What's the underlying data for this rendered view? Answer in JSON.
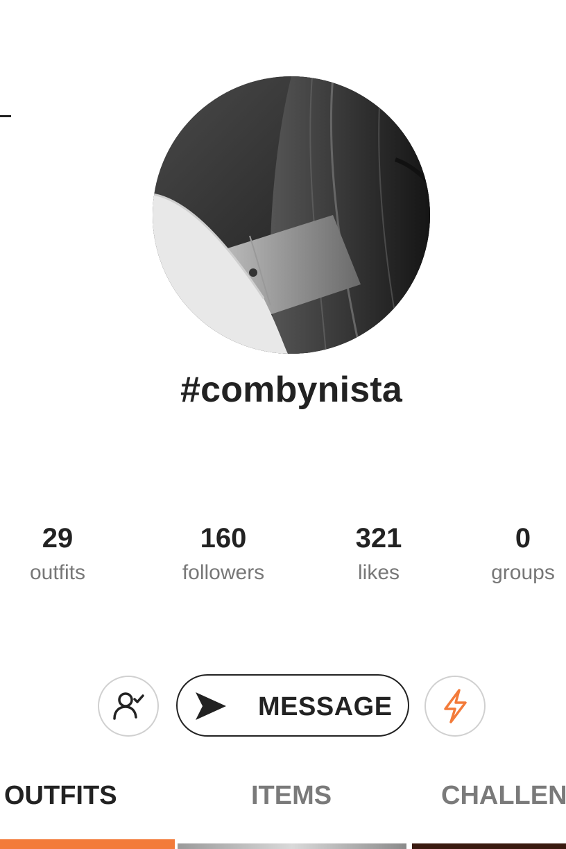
{
  "profile": {
    "username": "#combynista"
  },
  "stats": [
    {
      "value": "29",
      "label": "outfits"
    },
    {
      "value": "160",
      "label": "followers"
    },
    {
      "value": "321",
      "label": "likes"
    },
    {
      "value": "0",
      "label": "groups"
    }
  ],
  "actions": {
    "message_label": "MESSAGE"
  },
  "tabs": [
    {
      "label": "OUTFITS",
      "active": true
    },
    {
      "label": "ITEMS",
      "active": false
    },
    {
      "label": "CHALLENG",
      "active": false
    }
  ],
  "colors": {
    "accent": "#f37b3a",
    "text_primary": "#222222",
    "text_secondary": "#777777",
    "border": "#d0d0d0"
  }
}
